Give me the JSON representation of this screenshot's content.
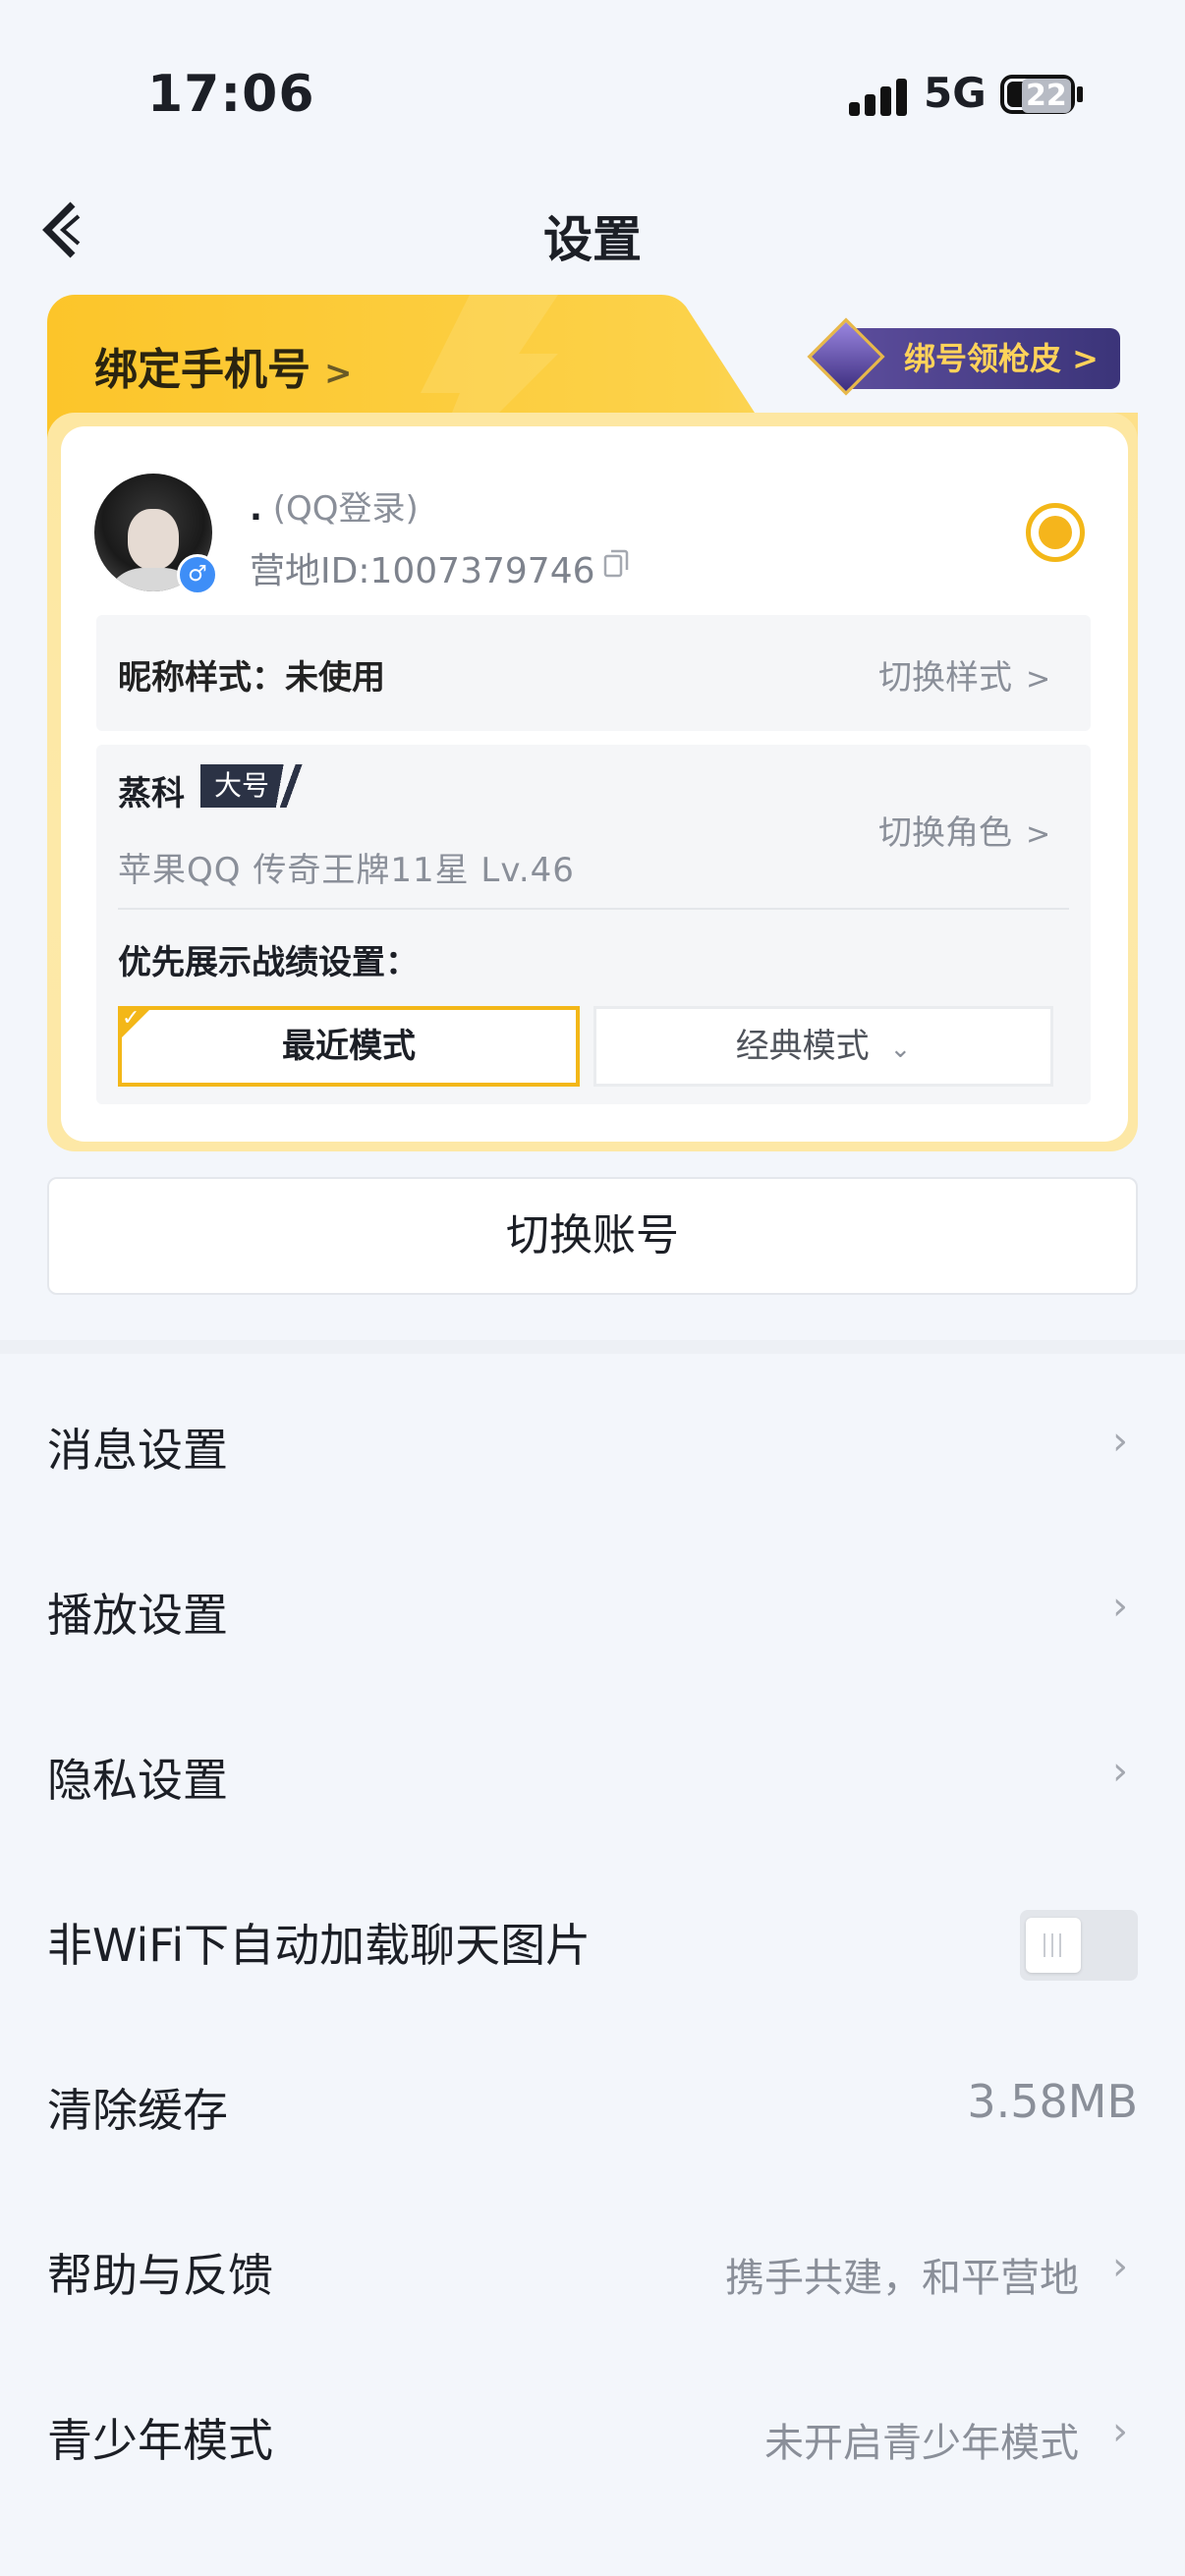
{
  "status": {
    "time": "17:06",
    "network": "5G",
    "battery": "22"
  },
  "header": {
    "title": "设置"
  },
  "card": {
    "bind_phone": "绑定手机号",
    "gun_badge": "绑号领枪皮",
    "login_prefix": ".",
    "login_type": "(QQ登录)",
    "camp_id": "营地ID:1007379746",
    "nickname_label": "昵称样式：未使用",
    "nickname_switch": "切换样式",
    "role_name": "蒸科",
    "role_tag": "大号",
    "role_info": "苹果QQ  传奇王牌11星  Lv.46",
    "role_switch": "切换角色",
    "pref_label": "优先展示战绩设置：",
    "mode_recent": "最近模式",
    "mode_classic": "经典模式"
  },
  "switch_account": "切换账号",
  "settings": [
    {
      "label": "消息设置"
    },
    {
      "label": "播放设置"
    },
    {
      "label": "隐私设置"
    },
    {
      "label": "非WiFi下自动加载聊天图片",
      "toggle": false
    },
    {
      "label": "清除缓存",
      "value": "3.58MB"
    },
    {
      "label": "帮助与反馈",
      "value": "携手共建，和平营地"
    },
    {
      "label": "青少年模式",
      "value": "未开启青少年模式"
    }
  ],
  "colors": {
    "accent": "#f5b51c",
    "background": "#f3f6fb",
    "text": "#1c1f26",
    "muted": "#8a8f99"
  }
}
